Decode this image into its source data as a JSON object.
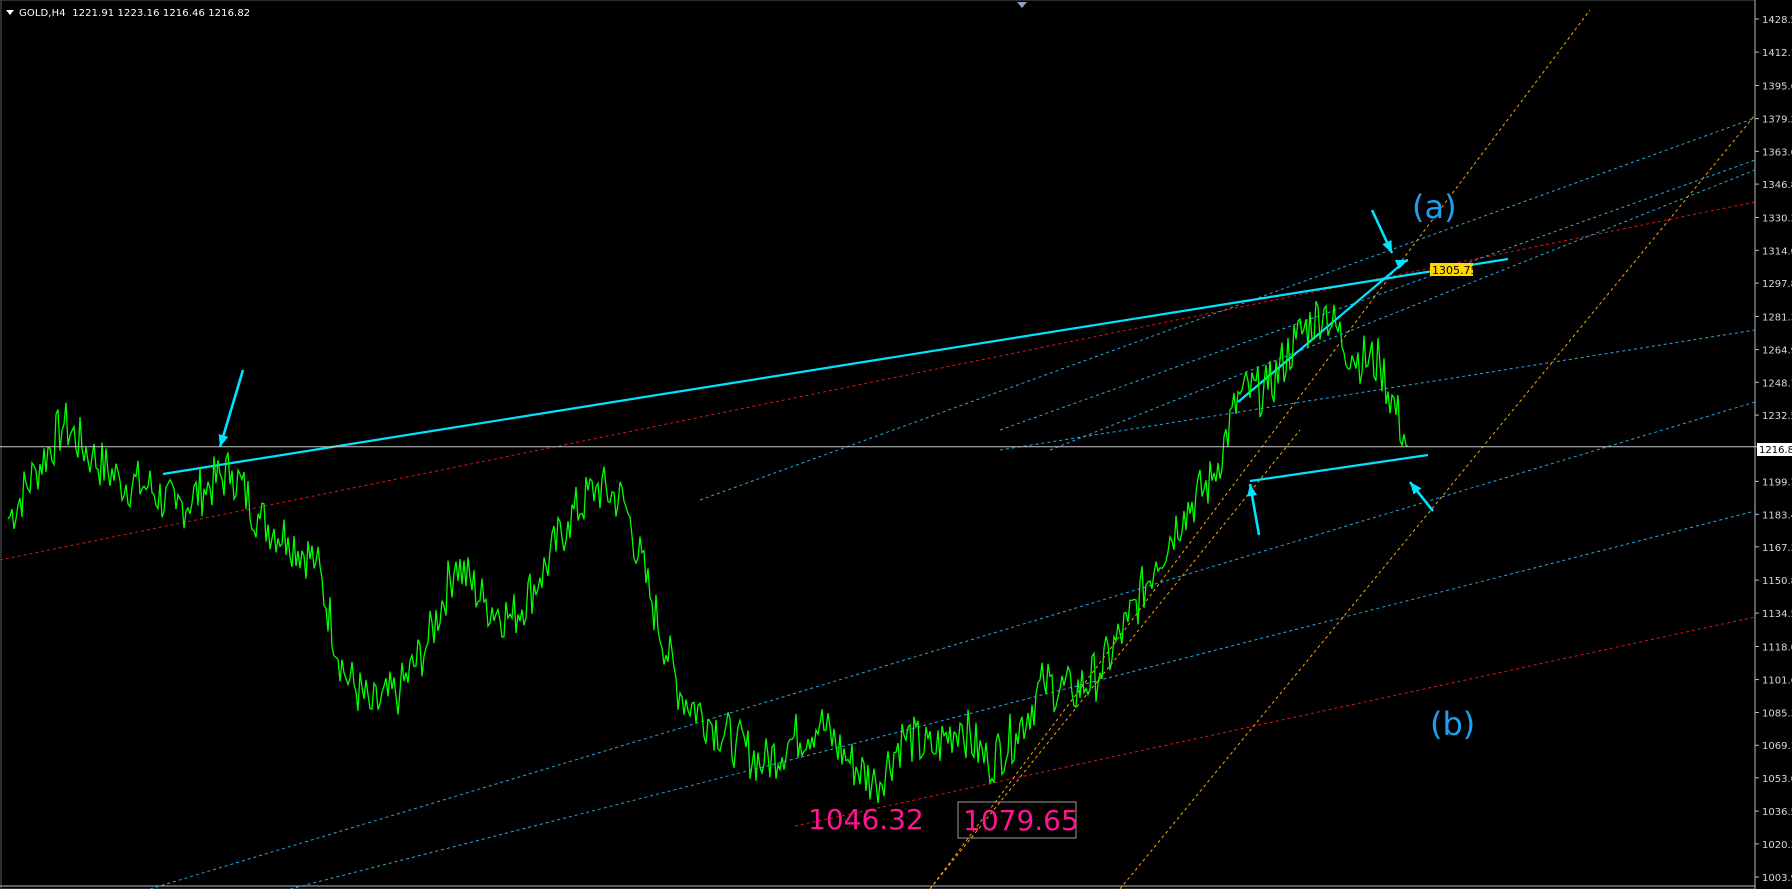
{
  "header": {
    "symbol": "GOLD,H4",
    "ohlc": "1221.91 1223.16 1216.46 1216.82"
  },
  "annotations": {
    "wave_a": "(a)",
    "wave_b": "(b)",
    "low_1": "1046.32",
    "low_2": "1079.65",
    "target_price": "1305.75"
  },
  "current_price_label": "1216.8",
  "colors": {
    "price": "#00ff00",
    "trendline": "#00e5ff",
    "channel": "#2aa7e6",
    "fib": "#ffa500",
    "red_line": "#e01515",
    "magenta": "#ff1493",
    "label_blue": "#1ea0f0",
    "target_bg": "#ffd600"
  },
  "chart_data": {
    "type": "line",
    "title": "GOLD,H4",
    "series": [
      {
        "name": "GOLD,H4",
        "x": [
          0,
          4,
          8,
          12,
          16,
          20,
          24,
          28,
          32,
          36,
          40,
          44,
          48,
          52,
          56,
          60,
          64,
          68,
          72,
          76,
          80,
          84,
          88,
          92,
          96,
          100
        ],
        "values": [
          1181,
          1205,
          1228,
          1212,
          1200,
          1197,
          1186,
          1196,
          1205,
          1181,
          1172,
          1160,
          1105,
          1087,
          1096,
          1120,
          1160,
          1140,
          1132,
          1152,
          1180,
          1197,
          1190,
          1140,
          1095,
          1082
        ]
      },
      {
        "name": "",
        "x": [
          100,
          104,
          108,
          112,
          116,
          120,
          124,
          128,
          132,
          136,
          140,
          144,
          148,
          152,
          156,
          160,
          164,
          168,
          172,
          176,
          180,
          184,
          188,
          192,
          196,
          200
        ],
        "values": [
          1082,
          1070,
          1060,
          1072,
          1080,
          1062,
          1050,
          1074,
          1066,
          1080,
          1060,
          1075,
          1100,
          1095,
          1105,
          1130,
          1160,
          1185,
          1200,
          1243,
          1245,
          1270,
          1285,
          1262,
          1258,
          1216.82
        ]
      }
    ],
    "y_ticks": [
      "1428.5",
      "1412.1",
      "1395.6",
      "1379.2",
      "1363.0",
      "1346.8",
      "1330.3",
      "1314.0",
      "1297.8",
      "1281.3",
      "1264.9",
      "1248.7",
      "1232.5",
      "1216.8",
      "1199.7",
      "1183.4",
      "1167.3",
      "1150.8",
      "1134.5",
      "1118.0",
      "1101.6",
      "1085.3",
      "1069.1",
      "1053.0",
      "1036.5",
      "1020.3",
      "1003.9"
    ],
    "ylim": [
      1003.9,
      1428.5
    ],
    "current_price": 1216.82,
    "grid": false
  }
}
